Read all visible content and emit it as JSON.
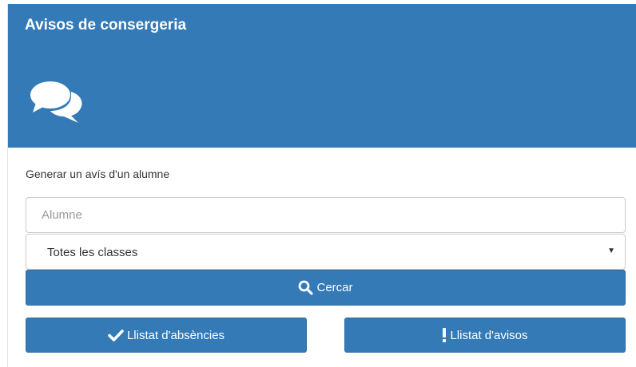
{
  "header": {
    "title": "Avisos de consergeria",
    "icon": "comments-icon"
  },
  "form": {
    "section_label": "Generar un avís d'un alumne",
    "student_input": {
      "placeholder": "Alumne",
      "value": ""
    },
    "class_select": {
      "selected": "Totes les classes"
    },
    "search_button": {
      "label": "Cercar",
      "icon": "search-icon"
    }
  },
  "actions": {
    "absences_button": {
      "label": "Llistat d'absències",
      "icon": "check-icon"
    },
    "notices_button": {
      "label": "Llistat d'avisos",
      "icon": "exclamation-icon"
    }
  },
  "colors": {
    "primary": "#337ab7",
    "primary_border": "#2e6da4",
    "text": "#333333",
    "input_border": "#cccccc"
  }
}
